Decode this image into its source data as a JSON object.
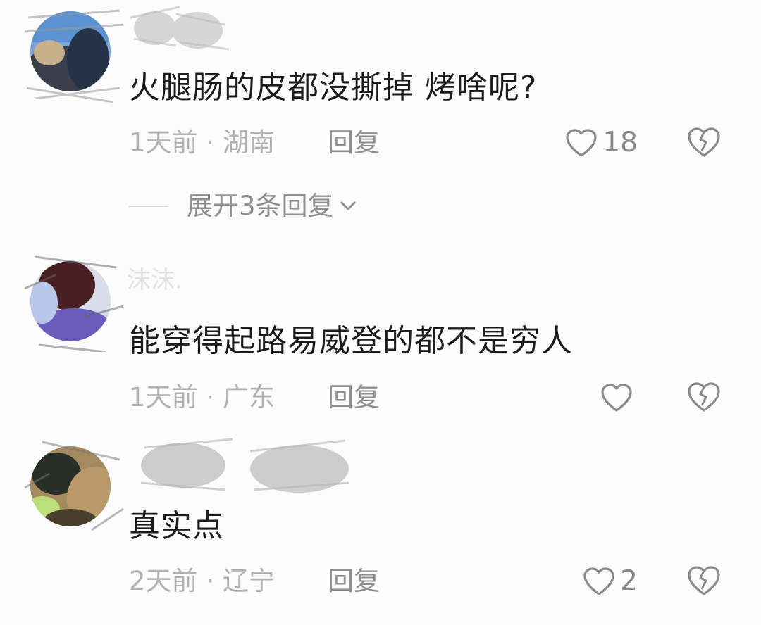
{
  "comments": [
    {
      "text": "火腿肠的皮都没撕掉 烤啥呢?",
      "time": "1天前",
      "location": "湖南",
      "reply_label": "回复",
      "likes": "18",
      "expand_label": "展开3条回复"
    },
    {
      "username": "沫沫.",
      "text": "能穿得起路易威登的都不是穷人",
      "time": "1天前",
      "location": "广东",
      "reply_label": "回复",
      "likes": ""
    },
    {
      "text": "真实点",
      "time": "2天前",
      "location": "辽宁",
      "reply_label": "回复",
      "likes": "2"
    }
  ],
  "meta_separator": "·",
  "colors": {
    "background": "#fcfcfc",
    "text_primary": "#1c1c1c",
    "text_meta": "#b2b2b2",
    "text_action": "#8f8f8f",
    "icon": "#8a8a8a"
  },
  "icons": {
    "like": "heart-outline",
    "dislike": "broken-heart-outline",
    "expand": "chevron-down"
  }
}
